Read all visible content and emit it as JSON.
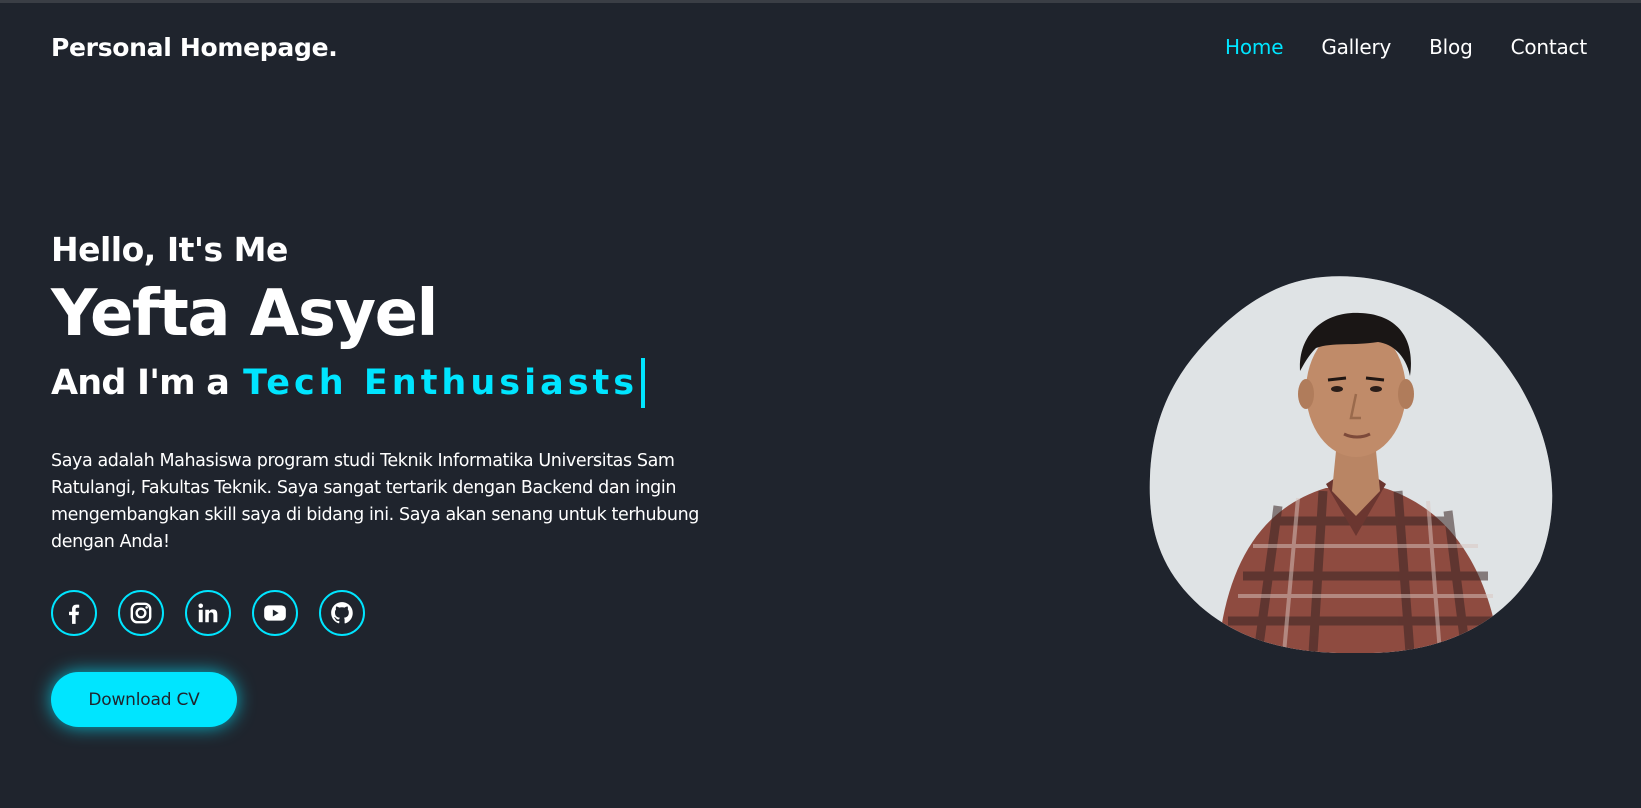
{
  "header": {
    "logo": "Personal Homepage.",
    "nav": [
      {
        "label": "Home",
        "active": true
      },
      {
        "label": "Gallery",
        "active": false
      },
      {
        "label": "Blog",
        "active": false
      },
      {
        "label": "Contact",
        "active": false
      }
    ]
  },
  "hero": {
    "greeting": "Hello, It's Me",
    "name": "Yefta Asyel",
    "role_prefix": "And I'm a",
    "role_typed": "Tech Enthusiasts",
    "bio": "Saya adalah Mahasiswa program studi Teknik Informatika Universitas Sam Ratulangi, Fakultas Teknik. Saya sangat tertarik dengan Backend dan ingin mengembangkan skill saya di bidang ini. Saya akan senang untuk terhubung dengan Anda!",
    "socials": [
      "facebook-icon",
      "instagram-icon",
      "linkedin-icon",
      "youtube-icon",
      "github-icon"
    ],
    "cta_label": "Download CV"
  },
  "colors": {
    "background": "#1f242d",
    "accent": "#00e5ff",
    "text": "#ffffff"
  }
}
